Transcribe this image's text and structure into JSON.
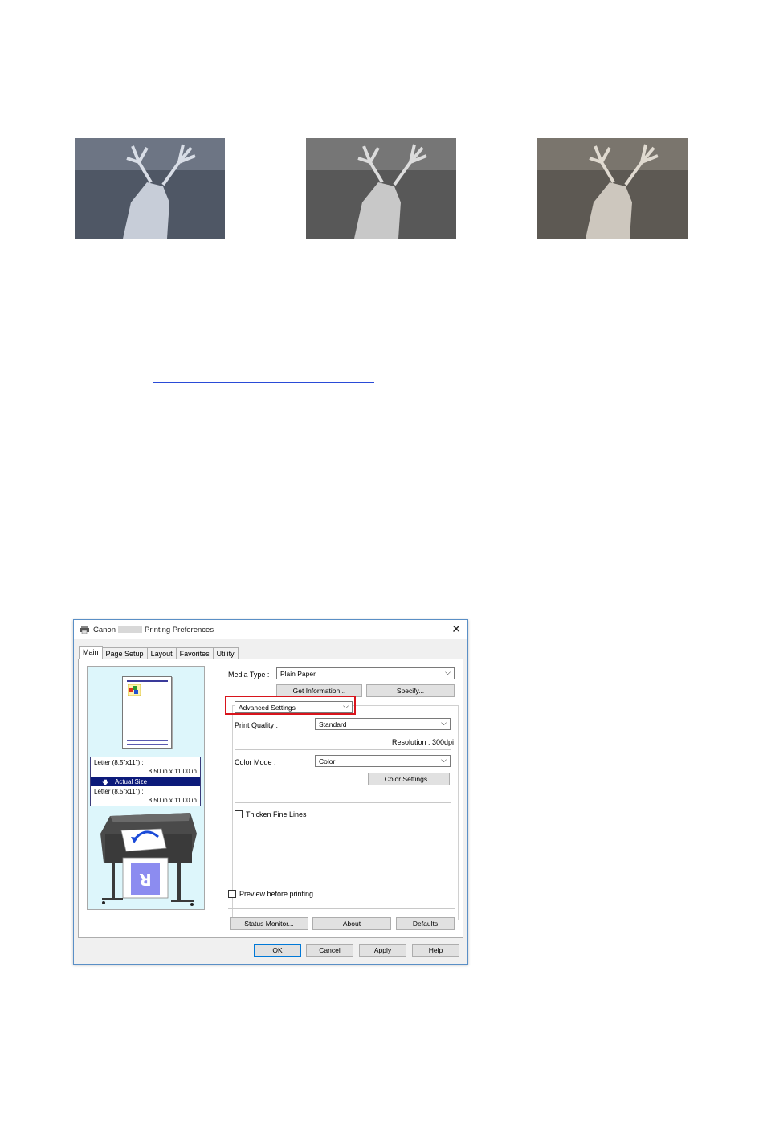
{
  "document": {
    "photos": [
      {
        "name": "deer photo, bluish black and white tone"
      },
      {
        "name": "deer photo, neutral black and white tone"
      },
      {
        "name": "deer photo, warm black and white tone"
      }
    ]
  },
  "dialog": {
    "title_prefix": "Canon",
    "title_suffix": "Printing Preferences",
    "close_glyph": "✕",
    "tabs": [
      "Main",
      "Page Setup",
      "Layout",
      "Favorites",
      "Utility"
    ],
    "preview": {
      "paper_size_label": "Letter (8.5\"x11\") :",
      "paper_size_dims": "8.50 in x 11.00 in",
      "scaling_label": "Actual Size",
      "output_size_label": "Letter (8.5\"x11\") :",
      "output_size_dims": "8.50 in x 11.00 in",
      "page_preview_letter": "R"
    },
    "media_type_label": "Media Type :",
    "media_type_value": "Plain Paper",
    "get_information_button": "Get Information...",
    "specify_button": "Specify...",
    "settings_mode_value": "Advanced Settings",
    "print_quality_label": "Print Quality :",
    "print_quality_value": "Standard",
    "resolution_text": "Resolution : 300dpi",
    "color_mode_label": "Color Mode :",
    "color_mode_value": "Color",
    "color_settings_button": "Color Settings...",
    "thicken_fine_lines_label": "Thicken Fine Lines",
    "thicken_fine_lines_checked": false,
    "preview_before_printing_label": "Preview before printing",
    "preview_before_printing_checked": false,
    "status_monitor_button": "Status Monitor...",
    "about_button": "About",
    "defaults_button": "Defaults",
    "ok_button": "OK",
    "cancel_button": "Cancel",
    "apply_button": "Apply",
    "help_button": "Help",
    "highlight_color": "#d8141c",
    "selection_color": "#0c1a7a"
  }
}
